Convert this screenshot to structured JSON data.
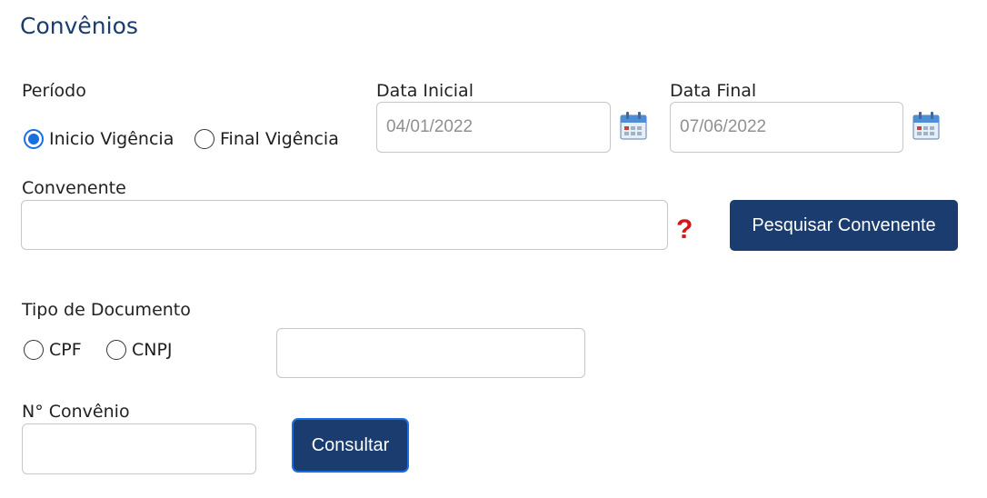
{
  "page": {
    "title": "Convênios"
  },
  "periodo": {
    "label": "Período",
    "options": [
      {
        "label": "Inicio Vigência",
        "checked": true
      },
      {
        "label": "Final Vigência",
        "checked": false
      }
    ]
  },
  "data_inicial": {
    "label": "Data Inicial",
    "value": "04/01/2022",
    "icon": "calendar-icon"
  },
  "data_final": {
    "label": "Data Final",
    "value": "07/06/2022",
    "icon": "calendar-icon"
  },
  "convenente": {
    "label": "Convenente",
    "value": "",
    "help_icon": "question-mark-icon",
    "button_label": "Pesquisar Convenente"
  },
  "tipo_documento": {
    "label": "Tipo de Documento",
    "options": [
      {
        "label": "CPF",
        "checked": false
      },
      {
        "label": "CNPJ",
        "checked": false
      }
    ],
    "value": ""
  },
  "convenio": {
    "label": "N° Convênio",
    "value": "",
    "button_label": "Consultar"
  },
  "colors": {
    "accent": "#1a3c6e",
    "radio_checked": "#1a6fe0",
    "help": "#d01818"
  }
}
